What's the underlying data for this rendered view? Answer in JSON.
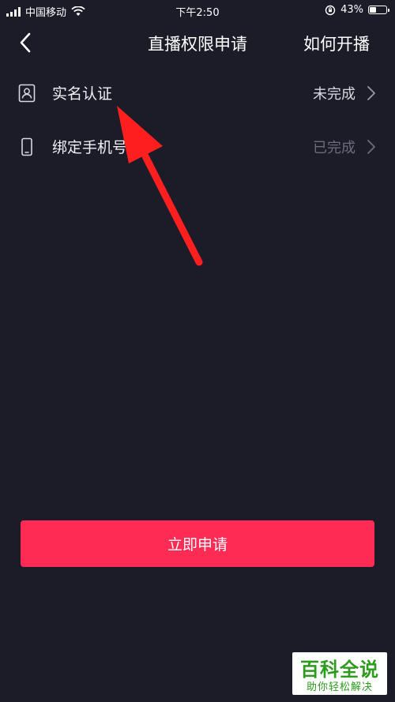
{
  "status_bar": {
    "carrier": "中国移动",
    "time": "下午2:50",
    "battery_percent": "43%",
    "battery_level": 0.43,
    "icons": [
      "signal-icon",
      "wifi-icon",
      "orientation-lock-icon",
      "battery-icon"
    ]
  },
  "nav": {
    "back_icon": "chevron-left-icon",
    "title": "直播权限申请",
    "action_label": "如何开播"
  },
  "items": [
    {
      "label": "实名认证",
      "status": "未完成",
      "icon": "id-card-icon"
    },
    {
      "label": "绑定手机号",
      "status": "已完成",
      "icon": "phone-icon"
    }
  ],
  "apply_button": {
    "label": "立即申请"
  },
  "watermark": {
    "title": "百科全说",
    "subtitle": "助你轻松解决"
  },
  "colors": {
    "background": "#1b1c28",
    "accent": "#fe2c55",
    "annotation_arrow": "#ff1f1f",
    "watermark_green": "#2e9a1e"
  }
}
